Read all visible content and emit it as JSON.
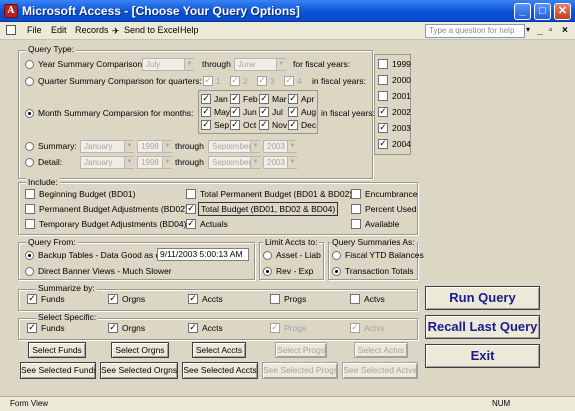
{
  "window": {
    "title": "Microsoft Access - [Choose Your Query Options]",
    "minimize": "_",
    "maximize": "□",
    "close": "✕"
  },
  "menu": {
    "items": [
      "File",
      "Edit",
      "Records",
      "Send to Excel",
      "Help"
    ],
    "help_placeholder": "Type a question for help",
    "mdi_controls": [
      "_",
      "▫",
      "×"
    ]
  },
  "query_type": {
    "group_label": "Query Type:",
    "year_summary_label": "Year Summary Comparison:",
    "year_from": "July",
    "year_through_label": "through",
    "year_to": "June",
    "for_fiscal_years_label": "for fiscal years:",
    "quarter_label": "Quarter Summary Comparison for quarters:",
    "quarters": [
      "1",
      "2",
      "3",
      "4"
    ],
    "in_fiscal_years_label": "in fiscal years:",
    "month_label": "Month Summary Comparsion for months:",
    "months": [
      "Jan",
      "Feb",
      "Mar",
      "Apr",
      "May",
      "Jun",
      "Jul",
      "Aug",
      "Sep",
      "Oct",
      "Nov",
      "Dec"
    ],
    "month_in_fiscal_years_label": "in fiscal years:",
    "summary_label": "Summary:",
    "summary_from_month": "January",
    "summary_from_year": "1998",
    "summary_through_label": "through",
    "summary_to_month": "September",
    "summary_to_year": "2003",
    "detail_label": "Detail:",
    "detail_from_month": "January",
    "detail_from_year": "1998",
    "detail_through_label": "through",
    "detail_to_month": "September",
    "detail_to_year": "2003",
    "selected": "month"
  },
  "fiscal_years": [
    {
      "year": "1999",
      "checked": false
    },
    {
      "year": "2000",
      "checked": false
    },
    {
      "year": "2001",
      "checked": false
    },
    {
      "year": "2002",
      "checked": true
    },
    {
      "year": "2003",
      "checked": true
    },
    {
      "year": "2004",
      "checked": true
    }
  ],
  "include": {
    "group_label": "Include:",
    "beginning_budget": "Beginning Budget (BD01)",
    "permanent_adj": "Permanent Budget Adjustments (BD02)",
    "temporary_adj": "Temporary Budget Adjustments (BD04)",
    "total_permanent": "Total Permanent Budget (BD01 & BD02)",
    "total_budget": "Total Budget (BD01, BD02 & BD04)",
    "actuals": "Actuals",
    "encumbrance": "Encumbrance",
    "percent_used": "Percent Used",
    "available": "Available"
  },
  "query_from": {
    "group_label": "Query From:",
    "backup_label": "Backup Tables - Data Good as of:",
    "backup_date": "9/11/2003 5:00:13 AM",
    "direct_label": "Direct Banner Views - Much Slower"
  },
  "limit_accts": {
    "group_label": "Limit Accts to:",
    "asset_liab": "Asset - Liab",
    "rev_exp": "Rev - Exp"
  },
  "query_summaries": {
    "group_label": "Query Summaries As:",
    "fiscal_ytd": "Fiscal YTD Balances",
    "transaction_totals": "Transaction Totals"
  },
  "summarize_by": {
    "group_label": "Summarize by:",
    "items": [
      "Funds",
      "Orgns",
      "Accts",
      "Progs",
      "Actvs"
    ]
  },
  "select_specific": {
    "group_label": "Select Specific:",
    "items": [
      "Funds",
      "Orgns",
      "Accts",
      "Progs",
      "Actvs"
    ]
  },
  "buttons": {
    "select_funds": "Select Funds",
    "select_orgns": "Select Orgns",
    "select_accts": "Select Accts",
    "select_progs": "Select Progs",
    "select_actvs": "Select Actvs",
    "see_funds": "See Selected Funds",
    "see_orgns": "See Selected Orgns",
    "see_accts": "See Selected Accts",
    "see_progs": "See Selected Progs",
    "see_actvs": "See Selected Actvs",
    "run_query": "Run Query",
    "recall_last_query": "Recall Last Query",
    "exit": "Exit"
  },
  "status": {
    "left": "Form View",
    "right": "NUM"
  },
  "colors": {
    "titlebar": "#0a53d8",
    "form_bg": "#dcd6c5",
    "big_button_text": "#1b1b8e"
  }
}
